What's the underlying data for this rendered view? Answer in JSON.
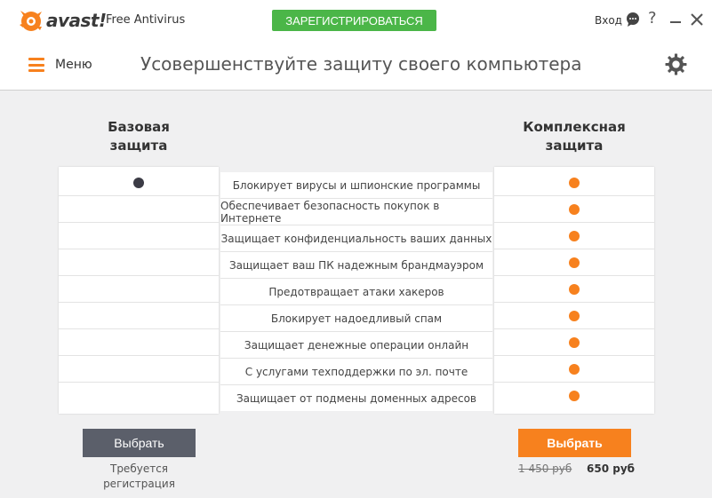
{
  "titlebar": {
    "logo_text": "avast!",
    "product_name": "Free Antivirus",
    "register_label": "ЗАРЕГИСТРИРОВАТЬСЯ",
    "login_label": "Вход",
    "icons": [
      "avast-logo-icon",
      "chat-icon",
      "help-icon",
      "minimize-icon",
      "close-icon"
    ],
    "help_glyph": "?"
  },
  "header": {
    "menu_label": "Меню",
    "page_title": "Усовершенствуйте защиту своего компьютера",
    "icons": [
      "menu-icon",
      "gear-icon"
    ]
  },
  "plans": {
    "basic": {
      "title": "Базовая\nзащита",
      "select_label": "Выбрать",
      "note": "Требуется\nрегистрация",
      "features_included": [
        true,
        false,
        false,
        false,
        false,
        false,
        false,
        false,
        false
      ],
      "dot_color": "#3b3b45"
    },
    "full": {
      "title": "Комплексная\nзащита",
      "select_label": "Выбрать",
      "old_price": "1 450 руб",
      "new_price": "650 руб",
      "features_included": [
        true,
        true,
        true,
        true,
        true,
        true,
        true,
        true,
        true
      ],
      "dot_color": "#f7811e"
    }
  },
  "features": [
    "Блокирует вирусы и шпионские программы",
    "Обеспечивает безопасность покупок в Интернете",
    "Защищает конфиденциальность ваших данных",
    "Защищает ваш ПК надежным брандмауэром",
    "Предотвращает атаки хакеров",
    "Блокирует надоедливый спам",
    "Защищает денежные операции онлайн",
    "С услугами техподдержки по эл. почте",
    "Защищает от подмены доменных адресов"
  ],
  "colors": {
    "accent": "#f7811e",
    "register_green": "#4bb648",
    "basic_button": "#5b5f6a",
    "background": "#f0f0f1"
  }
}
